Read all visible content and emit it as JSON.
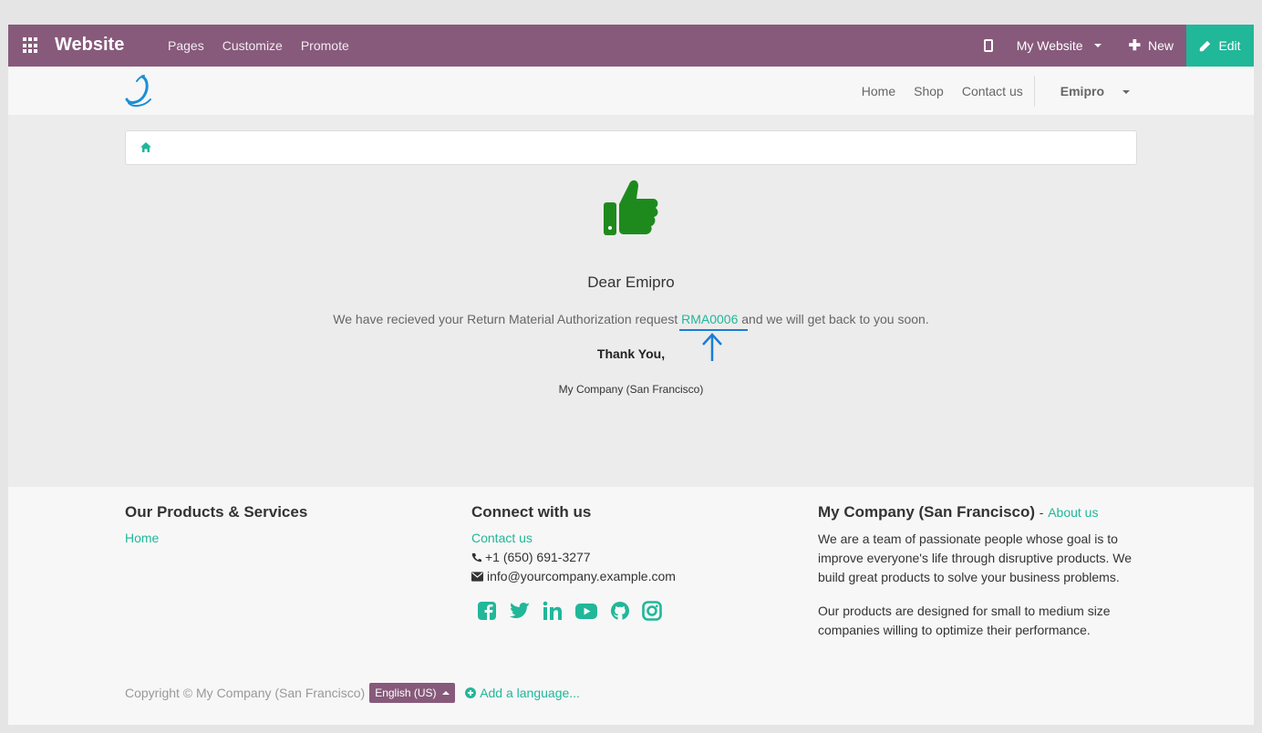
{
  "adminbar": {
    "brand": "Website",
    "menu": [
      "Pages",
      "Customize",
      "Promote"
    ],
    "my_website": "My Website",
    "new_label": "New",
    "edit_label": "Edit"
  },
  "siteheader": {
    "nav": [
      "Home",
      "Shop",
      "Contact us"
    ],
    "user": "Emipro"
  },
  "main": {
    "greeting": "Dear Emipro",
    "message_before": "We have recieved your Return Material Authorization request ",
    "rma_ref": "RMA0006",
    "message_after": " and we will get back to you soon.",
    "thanks": "Thank You,",
    "company": "My Company (San Francisco)"
  },
  "footer": {
    "col1": {
      "title": "Our Products & Services",
      "links": [
        "Home"
      ]
    },
    "col2": {
      "title": "Connect with us",
      "contact_link": "Contact us",
      "phone": "+1 (650) 691-3277",
      "email": "info@yourcompany.example.com",
      "social_icons": [
        "facebook-icon",
        "twitter-icon",
        "linkedin-icon",
        "youtube-icon",
        "github-icon",
        "instagram-icon"
      ]
    },
    "col3": {
      "title": "My Company (San Francisco)",
      "dash": "-",
      "about_link": "About us",
      "para1": "We are a team of passionate people whose goal is to improve everyone's life through disruptive products. We build great products to solve your business problems.",
      "para2": "Our products are designed for small to medium size companies willing to optimize their performance."
    },
    "copyright": "Copyright © My Company (San Francisco)",
    "language": "English (US)",
    "add_language": "Add a language..."
  },
  "colors": {
    "admin_bar": "#875a7b",
    "accent": "#21b799",
    "thumb": "#1e8a1e",
    "annotation": "#1a7dd4"
  }
}
